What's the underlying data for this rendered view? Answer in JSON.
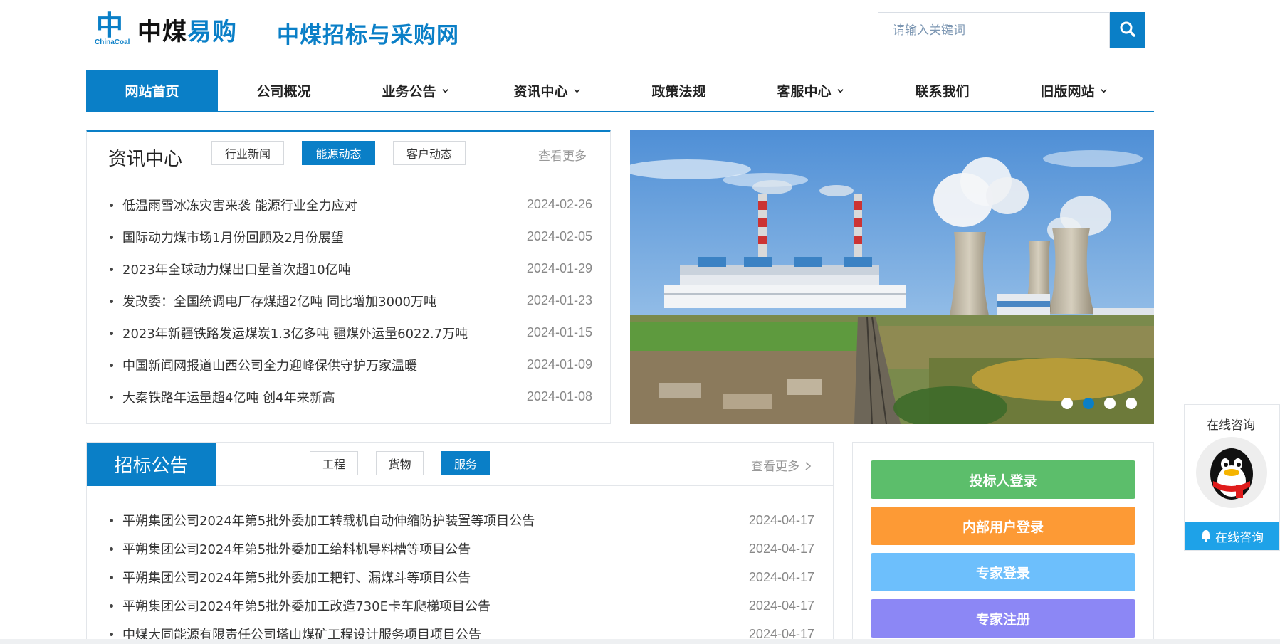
{
  "brand": {
    "logo_glyph": "中",
    "logo_en": "ChinaCoal",
    "logo_cn_black": "中煤",
    "logo_cn_blue": "易购",
    "site_title": "中煤招标与采购网",
    "accent_color": "#0a7fc7"
  },
  "search": {
    "placeholder": "请输入关键词",
    "icon": "search-icon"
  },
  "nav": {
    "items": [
      {
        "label": "网站首页",
        "active": true,
        "dropdown": false
      },
      {
        "label": "公司概况",
        "active": false,
        "dropdown": false
      },
      {
        "label": "业务公告",
        "active": false,
        "dropdown": true
      },
      {
        "label": "资讯中心",
        "active": false,
        "dropdown": true
      },
      {
        "label": "政策法规",
        "active": false,
        "dropdown": false
      },
      {
        "label": "客服中心",
        "active": false,
        "dropdown": true
      },
      {
        "label": "联系我们",
        "active": false,
        "dropdown": false
      },
      {
        "label": "旧版网站",
        "active": false,
        "dropdown": true
      }
    ]
  },
  "news": {
    "title": "资讯中心",
    "tabs": [
      {
        "label": "行业新闻",
        "active": false
      },
      {
        "label": "能源动态",
        "active": true
      },
      {
        "label": "客户动态",
        "active": false
      }
    ],
    "more": "查看更多",
    "items": [
      {
        "title": "低温雨雪冰冻灾害来袭 能源行业全力应对",
        "date": "2024-02-26"
      },
      {
        "title": "国际动力煤市场1月份回顾及2月份展望",
        "date": "2024-02-05"
      },
      {
        "title": "2023年全球动力煤出口量首次超10亿吨",
        "date": "2024-01-29"
      },
      {
        "title": "发改委：全国统调电厂存煤超2亿吨 同比增加3000万吨",
        "date": "2024-01-23"
      },
      {
        "title": "2023年新疆铁路发运煤炭1.3亿多吨 疆煤外运量6022.7万吨",
        "date": "2024-01-15"
      },
      {
        "title": "中国新闻网报道山西公司全力迎峰保供守护万家温暖",
        "date": "2024-01-09"
      },
      {
        "title": "大秦铁路年运量超4亿吨 创4年来新高",
        "date": "2024-01-08"
      }
    ]
  },
  "banner": {
    "slide_count": 4,
    "active_slide": 2
  },
  "bids": {
    "title": "招标公告",
    "tabs": [
      {
        "label": "工程",
        "active": false
      },
      {
        "label": "货物",
        "active": false
      },
      {
        "label": "服务",
        "active": true
      }
    ],
    "more": "查看更多",
    "more_icon": "chevron-right-icon",
    "items": [
      {
        "title": "平朔集团公司2024年第5批外委加工转载机自动伸缩防护装置等项目公告",
        "date": "2024-04-17"
      },
      {
        "title": "平朔集团公司2024年第5批外委加工给料机导料槽等项目公告",
        "date": "2024-04-17"
      },
      {
        "title": "平朔集团公司2024年第5批外委加工耙钉、漏煤斗等项目公告",
        "date": "2024-04-17"
      },
      {
        "title": "平朔集团公司2024年第5批外委加工改造730E卡车爬梯项目公告",
        "date": "2024-04-17"
      },
      {
        "title": "中煤大同能源有限责任公司塔山煤矿工程设计服务项目项目公告",
        "date": "2024-04-17"
      }
    ]
  },
  "login": {
    "buttons": [
      {
        "label": "投标人登录",
        "color": "#5cbe6b"
      },
      {
        "label": "内部用户登录",
        "color": "#fd9a35"
      },
      {
        "label": "专家登录",
        "color": "#6dbffc"
      },
      {
        "label": "专家注册",
        "color": "#8c87f5"
      }
    ]
  },
  "consult": {
    "title": "在线咨询",
    "button": "在线咨询",
    "avatar_icon": "qq-penguin-icon",
    "button_color": "#1ea2e8"
  }
}
